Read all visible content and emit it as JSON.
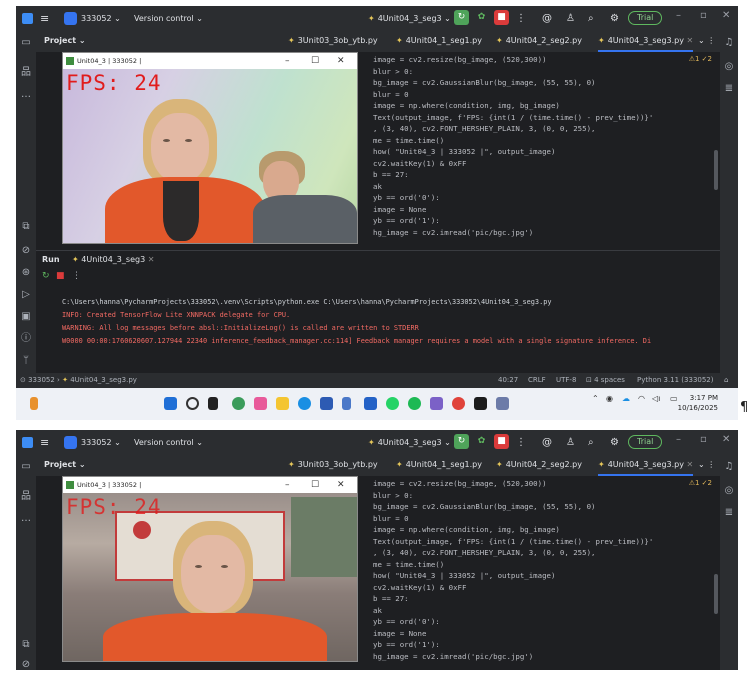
{
  "screenshots": [
    {
      "titlebar": {
        "project_name": "333052",
        "vcs_label": "Version control",
        "run_config": "4Unit04_3_seg3",
        "trial_label": "Trial"
      },
      "sidebar": {
        "project_label": "Project"
      },
      "tabs": [
        {
          "label": "3Unit03_3ob_ytb.py",
          "active": false
        },
        {
          "label": "4Unit04_1_seg1.py",
          "active": false
        },
        {
          "label": "4Unit04_2_seg2.py",
          "active": false
        },
        {
          "label": "4Unit04_3_seg3.py",
          "active": true
        }
      ],
      "editor": {
        "inspections": "⚠1 ✓2",
        "lines": [
          "image = cv2.resize(bg_image, (520,300))",
          "blur > 0:",
          " bg_image = cv2.GaussianBlur(bg_image, (55, 55), 0)",
          " blur = 0",
          "image = np.where(condition, img, bg_image)",
          "Text(output_image, f'FPS: {int(1 / (time.time() - prev_time))}'",
          "    , (3, 40), cv2.FONT_HERSHEY_PLAIN, 3, (0, 0, 255),",
          "me = time.time()",
          "how( \"Unit04_3 | 333052 |\", output_image)",
          "cv2.waitKey(1) & 0xFF",
          "b == 27:",
          "ak",
          "yb == ord('0'):",
          "image = None",
          "yb == ord('1'):",
          "hg_image = cv2.imread('pic/bgc.jpg')"
        ]
      },
      "cv_window": {
        "title": "Unit04_3 | 333052 |",
        "fps_text": "FPS: 24"
      },
      "run_panel": {
        "run_label": "Run",
        "config_tab": "4Unit04_3_seg3",
        "console": [
          {
            "text": "C:\\Users\\hanna\\PycharmProjects\\333052\\.venv\\Scripts\\python.exe C:\\Users\\hanna\\PycharmProjects\\333052\\4Unit04_3_seg3.py",
            "kind": "normal"
          },
          {
            "text": "INFO: Created TensorFlow Lite XNNPACK delegate for CPU.",
            "kind": "error"
          },
          {
            "text": "WARNING: All log messages before absl::InitializeLog() is called are written to STDERR",
            "kind": "error"
          },
          {
            "text": "W0000 00:00:1760620607.127944   22340 inference_feedback_manager.cc:114] Feedback manager requires a model with a single signature inference. Di",
            "kind": "error"
          }
        ]
      },
      "statusbar": {
        "breadcrumb_project": "333052",
        "breadcrumb_file": "4Unit04_3_seg3.py",
        "position": "40:27",
        "line_sep": "CRLF",
        "encoding": "UTF-8",
        "indent": "4 spaces",
        "interpreter": "Python 3.11 (333052)"
      },
      "taskbar": {
        "time": "3:17 PM",
        "date": "10/16/2025"
      }
    },
    {
      "titlebar": {
        "project_name": "333052",
        "vcs_label": "Version control",
        "run_config": "4Unit04_3_seg3",
        "trial_label": "Trial"
      },
      "sidebar": {
        "project_label": "Project"
      },
      "tabs": [
        {
          "label": "3Unit03_3ob_ytb.py",
          "active": false
        },
        {
          "label": "4Unit04_1_seg1.py",
          "active": false
        },
        {
          "label": "4Unit04_2_seg2.py",
          "active": false
        },
        {
          "label": "4Unit04_3_seg3.py",
          "active": true
        }
      ],
      "editor": {
        "inspections": "⚠1 ✓2",
        "lines": [
          "image = cv2.resize(bg_image, (520,300))",
          "blur > 0:",
          " bg_image = cv2.GaussianBlur(bg_image, (55, 55), 0)",
          " blur = 0",
          "image = np.where(condition, img, bg_image)",
          "Text(output_image, f'FPS: {int(1 / (time.time() - prev_time))}'",
          "    , (3, 40), cv2.FONT_HERSHEY_PLAIN, 3, (0, 0, 255),",
          "me = time.time()",
          "how( \"Unit04_3 | 333052 |\", output_image)",
          "cv2.waitKey(1) & 0xFF",
          "b == 27:",
          "ak",
          "yb == ord('0'):",
          "image = None",
          "yb == ord('1'):",
          "hg_image = cv2.imread('pic/bgc.jpg')"
        ]
      },
      "cv_window": {
        "title": "Unit04_3 | 333052 |",
        "fps_text": "FPS: 24"
      }
    }
  ],
  "pilcrow": "¶",
  "colors": {
    "ide_bg": "#1e1f22",
    "panel_bg": "#2b2d30",
    "accent": "#3574f0",
    "error_text": "#f26a63",
    "fps_text": "#e11c1c"
  }
}
